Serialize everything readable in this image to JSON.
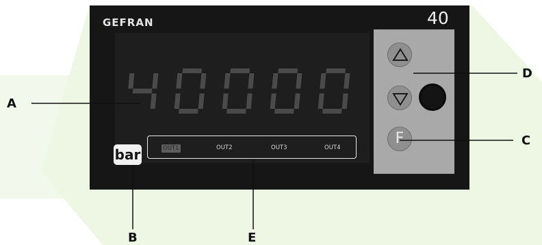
{
  "device": {
    "brand": "GEFRAN",
    "model": "40",
    "display_digits": "40000",
    "outputs": [
      "OUT1",
      "OUT2",
      "OUT3",
      "OUT4"
    ],
    "active_output": "OUT1",
    "bar_label": "bar",
    "key_f_label": "F"
  },
  "callouts": {
    "a": "A",
    "b": "B",
    "c": "C",
    "d": "D",
    "e": "E"
  },
  "colors": {
    "background_accent": "#eef6e4",
    "panel": "#161616",
    "keypad": "#a9a9a9",
    "segments": "#4a4a4a"
  }
}
